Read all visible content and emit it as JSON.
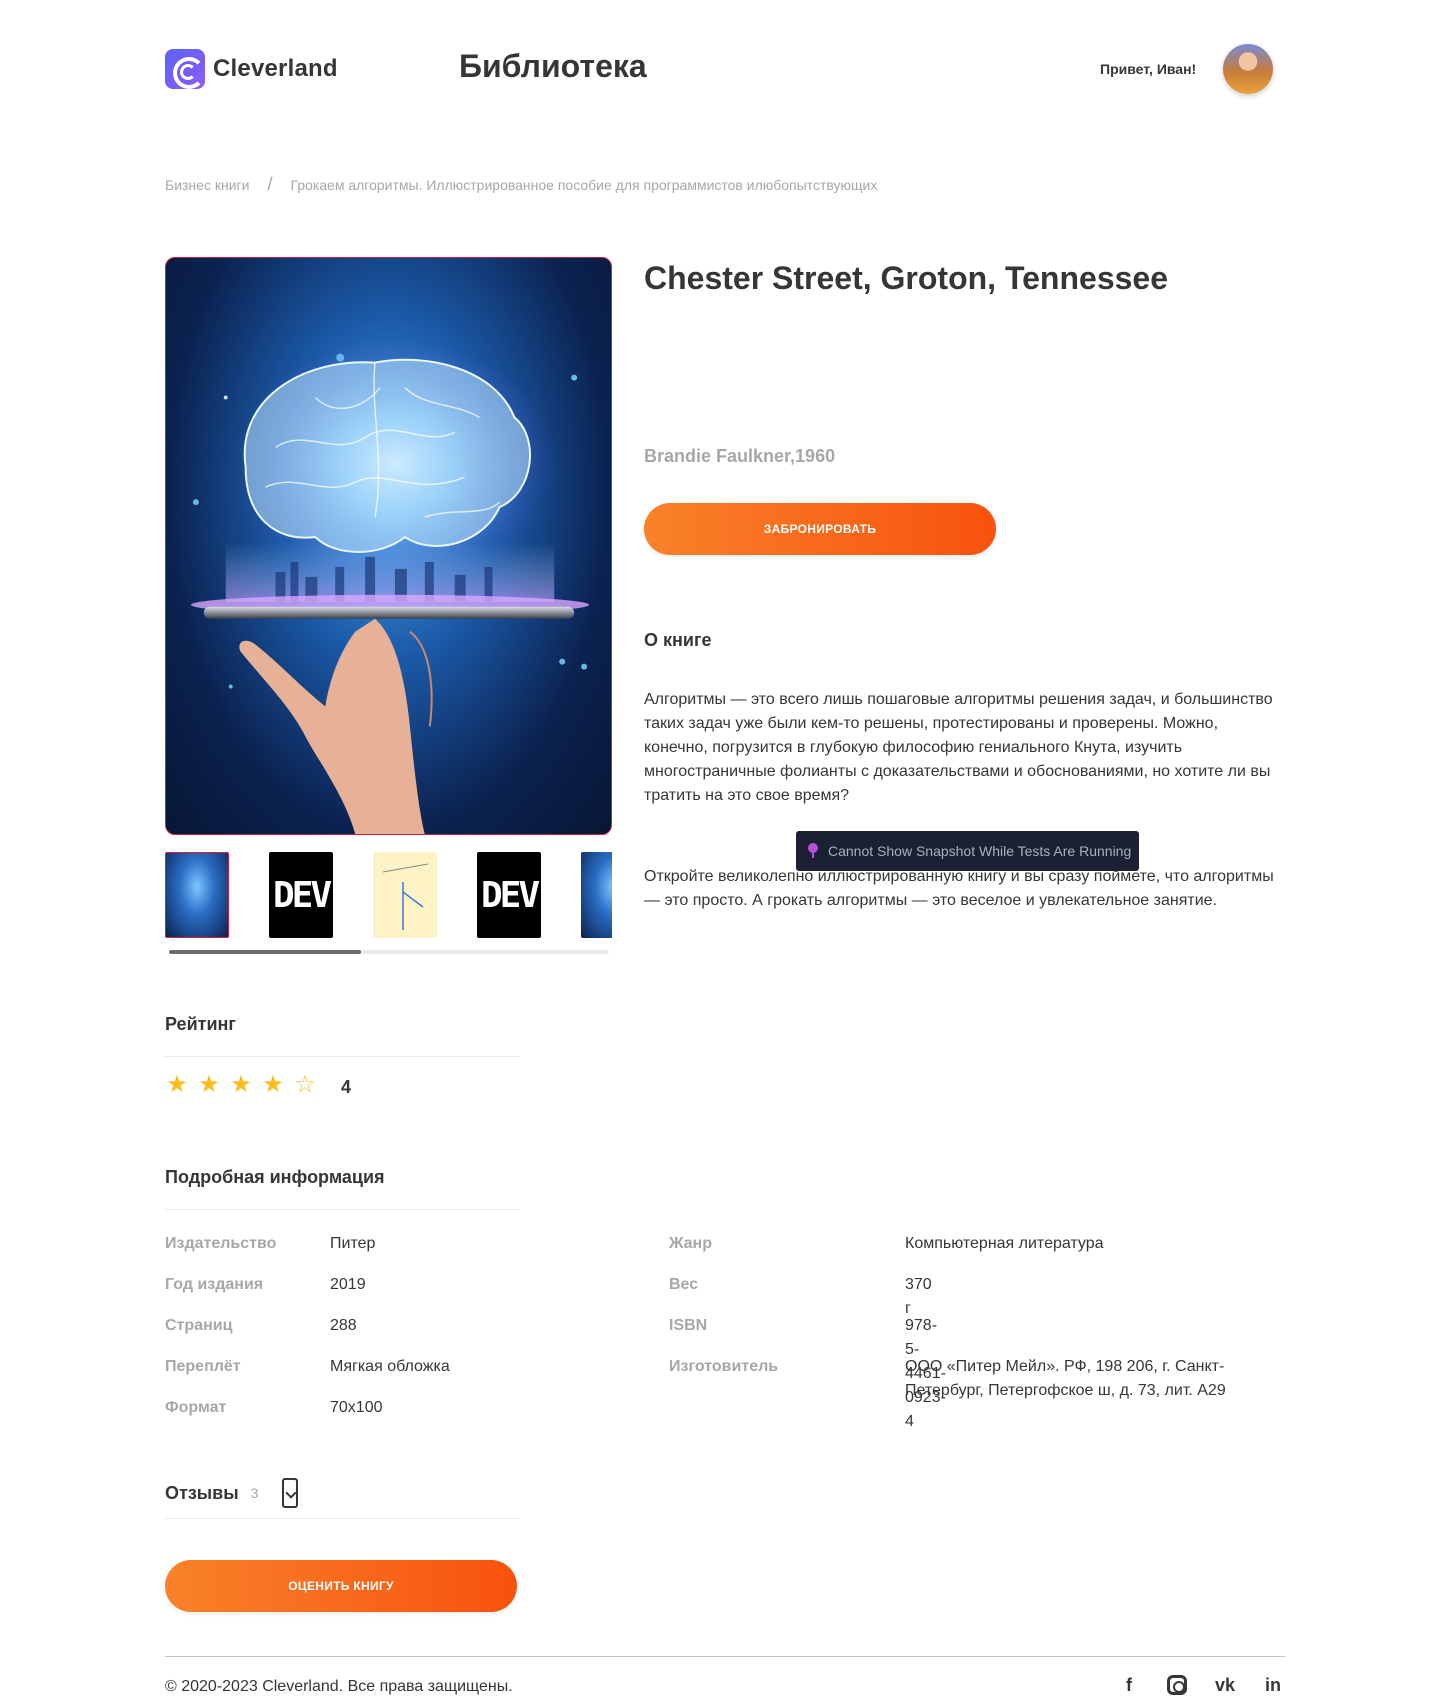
{
  "header": {
    "logo_text": "Cleverland",
    "page_title": "Библиотека",
    "greeting": "Привет, Иван!"
  },
  "breadcrumb": {
    "category": "Бизнес книги",
    "separator": "/",
    "current": "Грокаем алгоритмы. Иллюстрированное пособие для программистов илюбопытствующих"
  },
  "book": {
    "title": "Chester Street, Groton, Tennessee",
    "author": "Brandie Faulkner,1960",
    "book_button": "ЗАБРОНИРОВАТЬ",
    "thumbnails": [
      {
        "kind": "brain",
        "active": true
      },
      {
        "kind": "dev",
        "label": "DEV"
      },
      {
        "kind": "graph"
      },
      {
        "kind": "dev",
        "label": "DEV"
      },
      {
        "kind": "brain"
      }
    ],
    "thumbnail_scroll_position": 0.43
  },
  "about": {
    "heading": "О книге",
    "paragraph1": "Алгоритмы — это всего лишь пошаговые алгоритмы решения задач, и большинство таких задач уже были кем-то решены, протестированы и проверены. Можно, конечно, погрузится в глубокую философию гениального Кнута, изучить многостраничные фолианты с доказательствами и обоснованиями, но хотите ли вы тратить на это свое время?",
    "paragraph2": "Откройте великолепно иллюстрированную книгу и вы сразу поймете, что алгоритмы — это просто. А грокать алгоритмы — это веселое и увлекательное занятие."
  },
  "tooltip": {
    "text": "Cannot Show Snapshot While Tests Are Running",
    "pin_color": "#b84ee0"
  },
  "rating": {
    "heading": "Рейтинг",
    "value": "4",
    "stars_filled": 4,
    "stars_total": 5,
    "star_color": "#ffbc1f"
  },
  "details": {
    "heading": "Подробная информация",
    "left": [
      {
        "key": "Издательство",
        "value": "Питер"
      },
      {
        "key": "Год издания",
        "value": "2019"
      },
      {
        "key": "Страниц",
        "value": "288"
      },
      {
        "key": "Переплёт",
        "value": "Мягкая обложка"
      },
      {
        "key": "Формат",
        "value": "70х100"
      }
    ],
    "right": [
      {
        "key": "Жанр",
        "value": "Компьютерная литература"
      },
      {
        "key": "Вес",
        "value": "370 г"
      },
      {
        "key": "ISBN",
        "value": "978-5-4461-0923-4"
      },
      {
        "key": "Изготовитель",
        "value": "ООО «Питер Мейл». РФ, 198 206, г. Санкт-Петербург, Петергофское ш, д. 73, лит. А29"
      }
    ]
  },
  "reviews": {
    "heading": "Отзывы",
    "count": "3",
    "rate_button": "ОЦЕНИТЬ КНИГУ"
  },
  "footer": {
    "copyright": "© 2020-2023 Cleverland. Все права защищены.",
    "socials": [
      "facebook-icon",
      "instagram-icon",
      "vk-icon",
      "linkedin-icon"
    ],
    "facebook_glyph": "f",
    "vk_glyph": "vk",
    "linkedin_glyph": "in"
  },
  "colors": {
    "accent_start": "#f8822a",
    "accent_end": "#f8520d",
    "text": "#363636",
    "muted": "#a7a7a7",
    "brand": "#5b63f5"
  }
}
